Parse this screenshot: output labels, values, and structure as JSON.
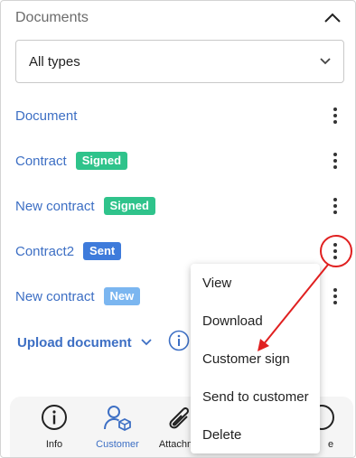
{
  "section": {
    "title": "Documents"
  },
  "filter": {
    "selected": "All types"
  },
  "documents": [
    {
      "name": "Document",
      "badge": "",
      "badge_color": ""
    },
    {
      "name": "Contract",
      "badge": "Signed",
      "badge_color": "#2fc38b"
    },
    {
      "name": "New contract",
      "badge": "Signed",
      "badge_color": "#2fc38b"
    },
    {
      "name": "Contract2",
      "badge": "Sent",
      "badge_color": "#3e7bdb"
    },
    {
      "name": "New contract",
      "badge": "New",
      "badge_color": "#7bb6f0"
    }
  ],
  "upload": {
    "label": "Upload document"
  },
  "bottom_nav": [
    {
      "label": "Info",
      "icon": "info-icon"
    },
    {
      "label": "Customer",
      "icon": "customer-icon"
    },
    {
      "label": "Attachm",
      "icon": "paperclip-icon"
    },
    {
      "label": "e",
      "icon": "generic-icon"
    }
  ],
  "context_menu": {
    "items": [
      "View",
      "Download",
      "Customer sign",
      "Send to customer",
      "Delete"
    ]
  },
  "colors": {
    "accent": "#3d6fc4",
    "annotation": "#e02020"
  }
}
